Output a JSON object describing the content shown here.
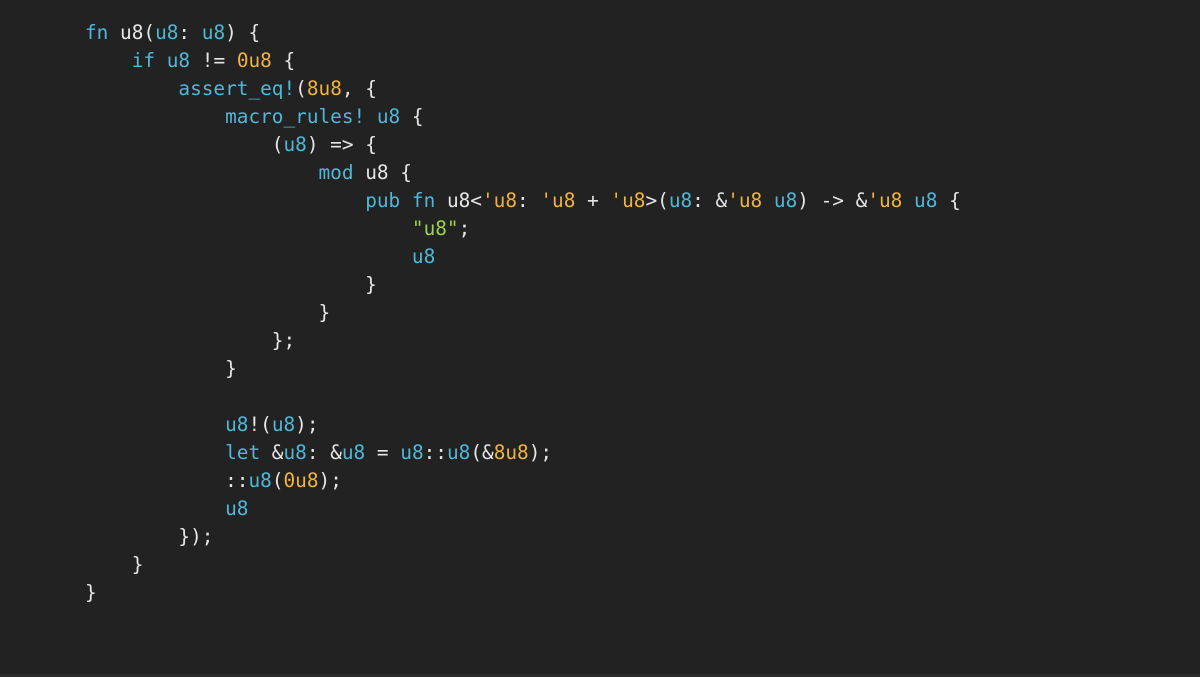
{
  "colors": {
    "background": "#222222",
    "plain": "#e6e6e6",
    "keyword": "#4fb8d8",
    "number": "#f0b43c",
    "lifetime": "#f0b43c",
    "string": "#9cd34a"
  },
  "code": {
    "language": "rust",
    "lines": [
      [
        [
          "kw",
          "fn"
        ],
        [
          "pl",
          " u8("
        ],
        [
          "id",
          "u8"
        ],
        [
          "pl",
          ": "
        ],
        [
          "ty",
          "u8"
        ],
        [
          "pl",
          ") {"
        ]
      ],
      [
        [
          "pl",
          "    "
        ],
        [
          "kw",
          "if"
        ],
        [
          "pl",
          " "
        ],
        [
          "id",
          "u8"
        ],
        [
          "pl",
          " != "
        ],
        [
          "num",
          "0u8"
        ],
        [
          "pl",
          " {"
        ]
      ],
      [
        [
          "pl",
          "        "
        ],
        [
          "mac",
          "assert_eq!"
        ],
        [
          "pl",
          "("
        ],
        [
          "num",
          "8u8"
        ],
        [
          "pl",
          ", {"
        ]
      ],
      [
        [
          "pl",
          "            "
        ],
        [
          "mac",
          "macro_rules!"
        ],
        [
          "pl",
          " "
        ],
        [
          "id",
          "u8"
        ],
        [
          "pl",
          " {"
        ]
      ],
      [
        [
          "pl",
          "                ("
        ],
        [
          "id",
          "u8"
        ],
        [
          "pl",
          ") => {"
        ]
      ],
      [
        [
          "pl",
          "                    "
        ],
        [
          "kw",
          "mod"
        ],
        [
          "pl",
          " u8 {"
        ]
      ],
      [
        [
          "pl",
          "                        "
        ],
        [
          "kw",
          "pub"
        ],
        [
          "pl",
          " "
        ],
        [
          "kw",
          "fn"
        ],
        [
          "pl",
          " u8<"
        ],
        [
          "lt",
          "'u8"
        ],
        [
          "pl",
          ": "
        ],
        [
          "lt",
          "'u8"
        ],
        [
          "pl",
          " + "
        ],
        [
          "lt",
          "'u8"
        ],
        [
          "pl",
          ">("
        ],
        [
          "id",
          "u8"
        ],
        [
          "pl",
          ": &"
        ],
        [
          "lt",
          "'u8"
        ],
        [
          "pl",
          " "
        ],
        [
          "ty",
          "u8"
        ],
        [
          "pl",
          ") -> &"
        ],
        [
          "lt",
          "'u8"
        ],
        [
          "pl",
          " "
        ],
        [
          "ty",
          "u8"
        ],
        [
          "pl",
          " {"
        ]
      ],
      [
        [
          "pl",
          "                            "
        ],
        [
          "str",
          "\"u8\""
        ],
        [
          "pl",
          ";"
        ]
      ],
      [
        [
          "pl",
          "                            "
        ],
        [
          "id",
          "u8"
        ]
      ],
      [
        [
          "pl",
          "                        }"
        ]
      ],
      [
        [
          "pl",
          "                    }"
        ]
      ],
      [
        [
          "pl",
          "                };"
        ]
      ],
      [
        [
          "pl",
          "            }"
        ]
      ],
      [
        [
          "pl",
          ""
        ]
      ],
      [
        [
          "pl",
          "            "
        ],
        [
          "id",
          "u8"
        ],
        [
          "pl",
          "!("
        ],
        [
          "id",
          "u8"
        ],
        [
          "pl",
          ");"
        ]
      ],
      [
        [
          "pl",
          "            "
        ],
        [
          "kw",
          "let"
        ],
        [
          "pl",
          " &"
        ],
        [
          "id",
          "u8"
        ],
        [
          "pl",
          ": &"
        ],
        [
          "ty",
          "u8"
        ],
        [
          "pl",
          " = "
        ],
        [
          "id",
          "u8"
        ],
        [
          "pl",
          "::"
        ],
        [
          "id",
          "u8"
        ],
        [
          "pl",
          "(&"
        ],
        [
          "num",
          "8u8"
        ],
        [
          "pl",
          ");"
        ]
      ],
      [
        [
          "pl",
          "            ::"
        ],
        [
          "id",
          "u8"
        ],
        [
          "pl",
          "("
        ],
        [
          "num",
          "0u8"
        ],
        [
          "pl",
          ");"
        ]
      ],
      [
        [
          "pl",
          "            "
        ],
        [
          "id",
          "u8"
        ]
      ],
      [
        [
          "pl",
          "        });"
        ]
      ],
      [
        [
          "pl",
          "    }"
        ]
      ],
      [
        [
          "pl",
          "}"
        ]
      ]
    ]
  }
}
